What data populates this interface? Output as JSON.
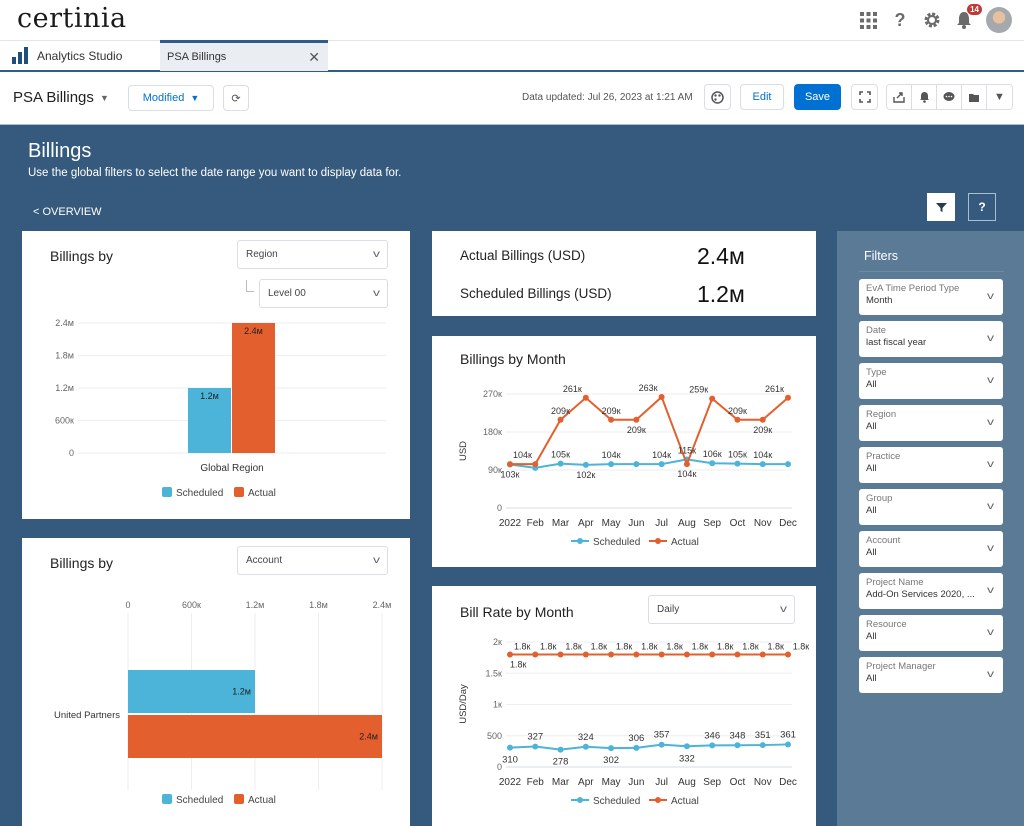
{
  "app": {
    "logo": "certinia",
    "notification_count": "14",
    "top_icons": [
      "app-launcher-icon",
      "help-icon",
      "setup-gear-icon",
      "notifications-bell-icon",
      "user-avatar"
    ]
  },
  "tabs": {
    "app_name": "Analytics Studio",
    "active_tab": "PSA Billings",
    "close_glyph": "✕"
  },
  "toolbar": {
    "dashboard_title": "PSA Billings",
    "modified_label": "Modified",
    "updated_text": "Data updated: Jul 26, 2023 at 1:21 AM",
    "edit_label": "Edit",
    "save_label": "Save"
  },
  "page": {
    "title": "Billings",
    "subtitle": "Use the global filters to select the date range you want to display data for.",
    "overview_link": "< OVERVIEW",
    "help_label": "?"
  },
  "kpis": {
    "actual_label": "Actual Billings (USD)",
    "actual_value": "2.4м",
    "scheduled_label": "Scheduled Billings (USD)",
    "scheduled_value": "1.2м"
  },
  "cards": {
    "region": {
      "title": "Billings by",
      "select": "Region",
      "level_select": "Level 00"
    },
    "account": {
      "title": "Billings by",
      "select": "Account"
    },
    "month": {
      "title": "Billings by Month"
    },
    "rate": {
      "title": "Bill Rate by Month",
      "select": "Daily"
    }
  },
  "colors": {
    "scheduled": "#4bb4d8",
    "actual": "#e35f2d",
    "brand_blue": "#0070d2",
    "page_bg": "#355a7d",
    "filter_panel": "#5b7a96"
  },
  "filters": {
    "title": "Filters",
    "items": [
      {
        "label": "EvA Time Period Type",
        "value": "Month"
      },
      {
        "label": "Date",
        "value": "last fiscal year"
      },
      {
        "label": "Type",
        "value": "All"
      },
      {
        "label": "Region",
        "value": "All"
      },
      {
        "label": "Practice",
        "value": "All"
      },
      {
        "label": "Group",
        "value": "All"
      },
      {
        "label": "Account",
        "value": "All"
      },
      {
        "label": "Project Name",
        "value": "Add-On Services 2020, ..."
      },
      {
        "label": "Resource",
        "value": "All"
      },
      {
        "label": "Project Manager",
        "value": "All"
      }
    ]
  },
  "chart_data": [
    {
      "id": "region",
      "type": "bar",
      "orientation": "vertical",
      "title": "Billings by Region",
      "categories": [
        "Global Region"
      ],
      "series": [
        {
          "name": "Scheduled",
          "values": [
            1.2
          ],
          "labels": [
            "1.2м"
          ]
        },
        {
          "name": "Actual",
          "values": [
            2.4
          ],
          "labels": [
            "2.4м"
          ]
        }
      ],
      "unit": "millions USD",
      "ylim": [
        0,
        2.4
      ],
      "yticks": [
        0,
        0.6,
        1.2,
        1.8,
        2.4
      ],
      "ytick_labels": [
        "0",
        "600к",
        "1.2м",
        "1.8м",
        "2.4м"
      ],
      "legend": "bottom",
      "grid": true
    },
    {
      "id": "account",
      "type": "bar",
      "orientation": "horizontal",
      "title": "Billings by Account",
      "categories": [
        "United Partners"
      ],
      "series": [
        {
          "name": "Scheduled",
          "values": [
            1.2
          ],
          "labels": [
            "1.2м"
          ]
        },
        {
          "name": "Actual",
          "values": [
            2.4
          ],
          "labels": [
            "2.4м"
          ]
        }
      ],
      "unit": "millions USD",
      "xlim": [
        0,
        2.4
      ],
      "xticks": [
        0,
        0.6,
        1.2,
        1.8,
        2.4
      ],
      "xtick_labels": [
        "0",
        "600к",
        "1.2м",
        "1.8м",
        "2.4м"
      ],
      "legend": "bottom",
      "grid": true
    },
    {
      "id": "month",
      "type": "line",
      "title": "Billings by Month",
      "ylabel": "USD",
      "categories": [
        "2022",
        "Feb",
        "Mar",
        "Apr",
        "May",
        "Jun",
        "Jul",
        "Aug",
        "Sep",
        "Oct",
        "Nov",
        "Dec"
      ],
      "series": [
        {
          "name": "Scheduled",
          "values": [
            103,
            95,
            105,
            102,
            104,
            104,
            104,
            115,
            106,
            105,
            104,
            104
          ],
          "labels": [
            "103к",
            "",
            "105к",
            "102к",
            "104к",
            "",
            "104к",
            "115к",
            "106к",
            "105к",
            "104к",
            ""
          ]
        },
        {
          "name": "Actual",
          "values": [
            104,
            104,
            209,
            261,
            209,
            209,
            263,
            104,
            259,
            209,
            209,
            261
          ],
          "labels": [
            "104к",
            "",
            "209к",
            "261к",
            "209к",
            "209к",
            "263к",
            "104к",
            "259к",
            "209к",
            "209к",
            "261к"
          ]
        }
      ],
      "unit": "thousands USD",
      "ylim": [
        0,
        270
      ],
      "yticks": [
        0,
        90,
        180,
        270
      ],
      "ytick_labels": [
        "0",
        "90к",
        "180к",
        "270к"
      ],
      "legend": "bottom",
      "grid": true
    },
    {
      "id": "rate",
      "type": "line",
      "title": "Bill Rate by Month",
      "ylabel": "USD/Day",
      "categories": [
        "2022",
        "Feb",
        "Mar",
        "Apr",
        "May",
        "Jun",
        "Jul",
        "Aug",
        "Sep",
        "Oct",
        "Nov",
        "Dec"
      ],
      "series": [
        {
          "name": "Scheduled",
          "values": [
            310,
            327,
            278,
            324,
            302,
            306,
            357,
            332,
            346,
            348,
            351,
            361
          ],
          "labels": [
            "310",
            "327",
            "278",
            "324",
            "302",
            "306",
            "357",
            "332",
            "346",
            "348",
            "351",
            "361"
          ]
        },
        {
          "name": "Actual",
          "values": [
            1800,
            1800,
            1800,
            1800,
            1800,
            1800,
            1800,
            1800,
            1800,
            1800,
            1800,
            1800
          ],
          "labels": [
            "1.8к",
            "1.8к",
            "1.8к",
            "1.8к",
            "1.8к",
            "1.8к",
            "1.8к",
            "1.8к",
            "1.8к",
            "1.8к",
            "1.8к",
            "1.8к"
          ]
        }
      ],
      "ylim": [
        0,
        2000
      ],
      "yticks": [
        0,
        500,
        1000,
        1500,
        2000
      ],
      "ytick_labels": [
        "0",
        "500",
        "1к",
        "1.5к",
        "2к"
      ],
      "legend": "bottom",
      "grid": true
    }
  ]
}
